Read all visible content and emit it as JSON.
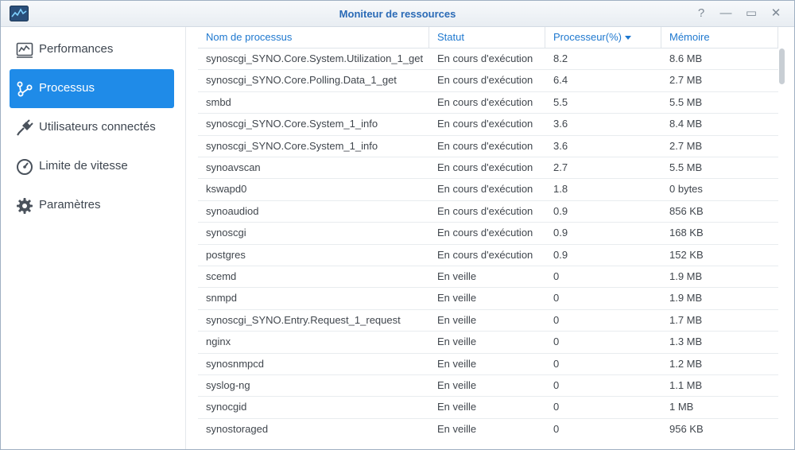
{
  "window": {
    "title": "Moniteur de ressources",
    "app_icon": "resource-monitor-icon",
    "controls": {
      "help": "?",
      "minimize": "—",
      "maximize": "▭",
      "close": "✕"
    }
  },
  "sidebar": {
    "items": [
      {
        "label": "Performances",
        "icon": "performance-chart-icon",
        "active": false
      },
      {
        "label": "Processus",
        "icon": "process-icon",
        "active": true
      },
      {
        "label": "Utilisateurs connectés",
        "icon": "plug-icon",
        "active": false
      },
      {
        "label": "Limite de vitesse",
        "icon": "speed-limit-icon",
        "active": false
      },
      {
        "label": "Paramètres",
        "icon": "gear-icon",
        "active": false
      }
    ]
  },
  "table": {
    "columns": [
      "Nom de processus",
      "Statut",
      "Processeur(%)",
      "Mémoire"
    ],
    "sorted_column": "Processeur(%)",
    "rows": [
      [
        "synoscgi_SYNO.Core.System.Utilization_1_get",
        "En cours d'exécution",
        "8.2",
        "8.6 MB"
      ],
      [
        "synoscgi_SYNO.Core.Polling.Data_1_get",
        "En cours d'exécution",
        "6.4",
        "2.7 MB"
      ],
      [
        "smbd",
        "En cours d'exécution",
        "5.5",
        "5.5 MB"
      ],
      [
        "synoscgi_SYNO.Core.System_1_info",
        "En cours d'exécution",
        "3.6",
        "8.4 MB"
      ],
      [
        "synoscgi_SYNO.Core.System_1_info",
        "En cours d'exécution",
        "3.6",
        "2.7 MB"
      ],
      [
        "synoavscan",
        "En cours d'exécution",
        "2.7",
        "5.5 MB"
      ],
      [
        "kswapd0",
        "En cours d'exécution",
        "1.8",
        "0 bytes"
      ],
      [
        "synoaudiod",
        "En cours d'exécution",
        "0.9",
        "856 KB"
      ],
      [
        "synoscgi",
        "En cours d'exécution",
        "0.9",
        "168 KB"
      ],
      [
        "postgres",
        "En cours d'exécution",
        "0.9",
        "152 KB"
      ],
      [
        "scemd",
        "En veille",
        "0",
        "1.9 MB"
      ],
      [
        "snmpd",
        "En veille",
        "0",
        "1.9 MB"
      ],
      [
        "synoscgi_SYNO.Entry.Request_1_request",
        "En veille",
        "0",
        "1.7 MB"
      ],
      [
        "nginx",
        "En veille",
        "0",
        "1.3 MB"
      ],
      [
        "synosnmpcd",
        "En veille",
        "0",
        "1.2 MB"
      ],
      [
        "syslog-ng",
        "En veille",
        "0",
        "1.1 MB"
      ],
      [
        "synocgid",
        "En veille",
        "0",
        "1 MB"
      ],
      [
        "synostoraged",
        "En veille",
        "0",
        "956 KB"
      ]
    ]
  },
  "colors": {
    "accent": "#1f8be8",
    "header_text": "#1e78cf",
    "title_text": "#2a6ab6"
  }
}
